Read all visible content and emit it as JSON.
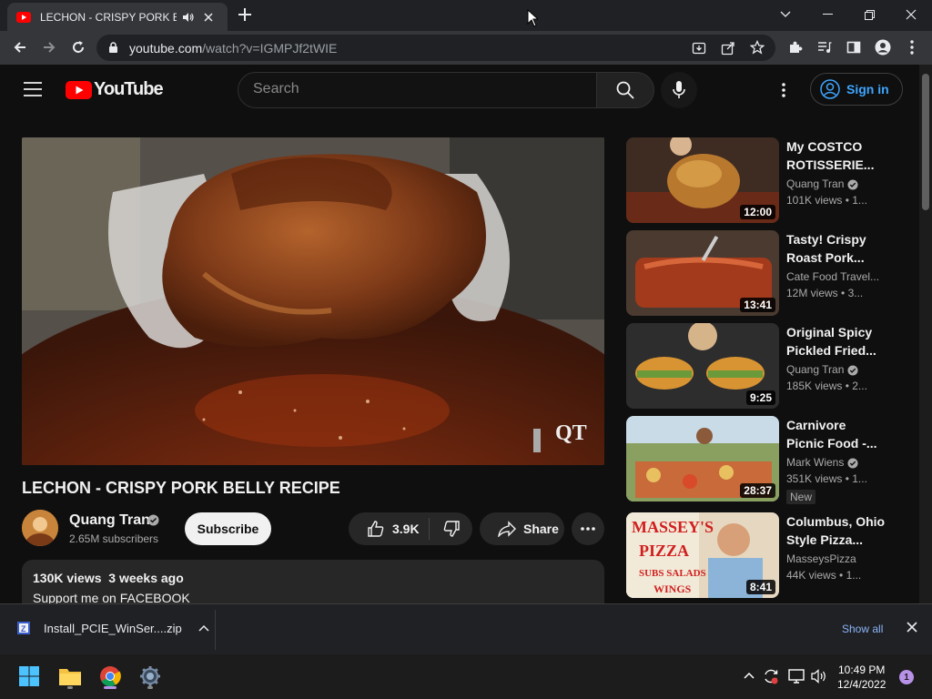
{
  "browser": {
    "tab_title": "LECHON - CRISPY PORK BELLY RECIPE",
    "new_tab_label": "+",
    "url_host": "youtube.com",
    "url_path": "/watch?v=IGMPJf2tWIE"
  },
  "youtube": {
    "logo_text": "YouTube",
    "search_placeholder": "Search",
    "signin_label": "Sign in"
  },
  "video": {
    "title": "LECHON - CRISPY PORK BELLY RECIPE",
    "watermark": "QT",
    "channel": "Quang Tran",
    "subscribers": "2.65M subscribers",
    "subscribe_label": "Subscribe",
    "likes": "3.9K",
    "share_label": "Share",
    "views": "130K views",
    "age": "3 weeks ago",
    "description_line": "Support me on FACEBOOK"
  },
  "recommendations": [
    {
      "title": "My COSTCO ROTISSERIE...",
      "channel": "Quang Tran",
      "verified": true,
      "views": "101K views",
      "age": "• 1...",
      "duration": "12:00",
      "new": false
    },
    {
      "title": "Tasty! Crispy Roast Pork...",
      "channel": "Cate Food Travel...",
      "verified": false,
      "views": "12M views",
      "age": "• 3...",
      "duration": "13:41",
      "new": false
    },
    {
      "title": "Original Spicy Pickled Fried...",
      "channel": "Quang Tran",
      "verified": true,
      "views": "185K views",
      "age": "• 2...",
      "duration": "9:25",
      "new": false
    },
    {
      "title": "Carnivore Picnic Food -...",
      "channel": "Mark Wiens",
      "verified": true,
      "views": "351K views",
      "age": "• 1...",
      "duration": "28:37",
      "new": true,
      "new_label": "New"
    },
    {
      "title": "Columbus, Ohio Style Pizza...",
      "channel": "MasseysPizza",
      "verified": false,
      "views": "44K views",
      "age": "• 1...",
      "duration": "8:41",
      "new": false
    }
  ],
  "download_bar": {
    "file_name": "Install_PCIE_WinSer....zip",
    "show_all_label": "Show all"
  },
  "taskbar": {
    "time": "10:49 PM",
    "date": "12/4/2022",
    "notification_count": "1"
  }
}
